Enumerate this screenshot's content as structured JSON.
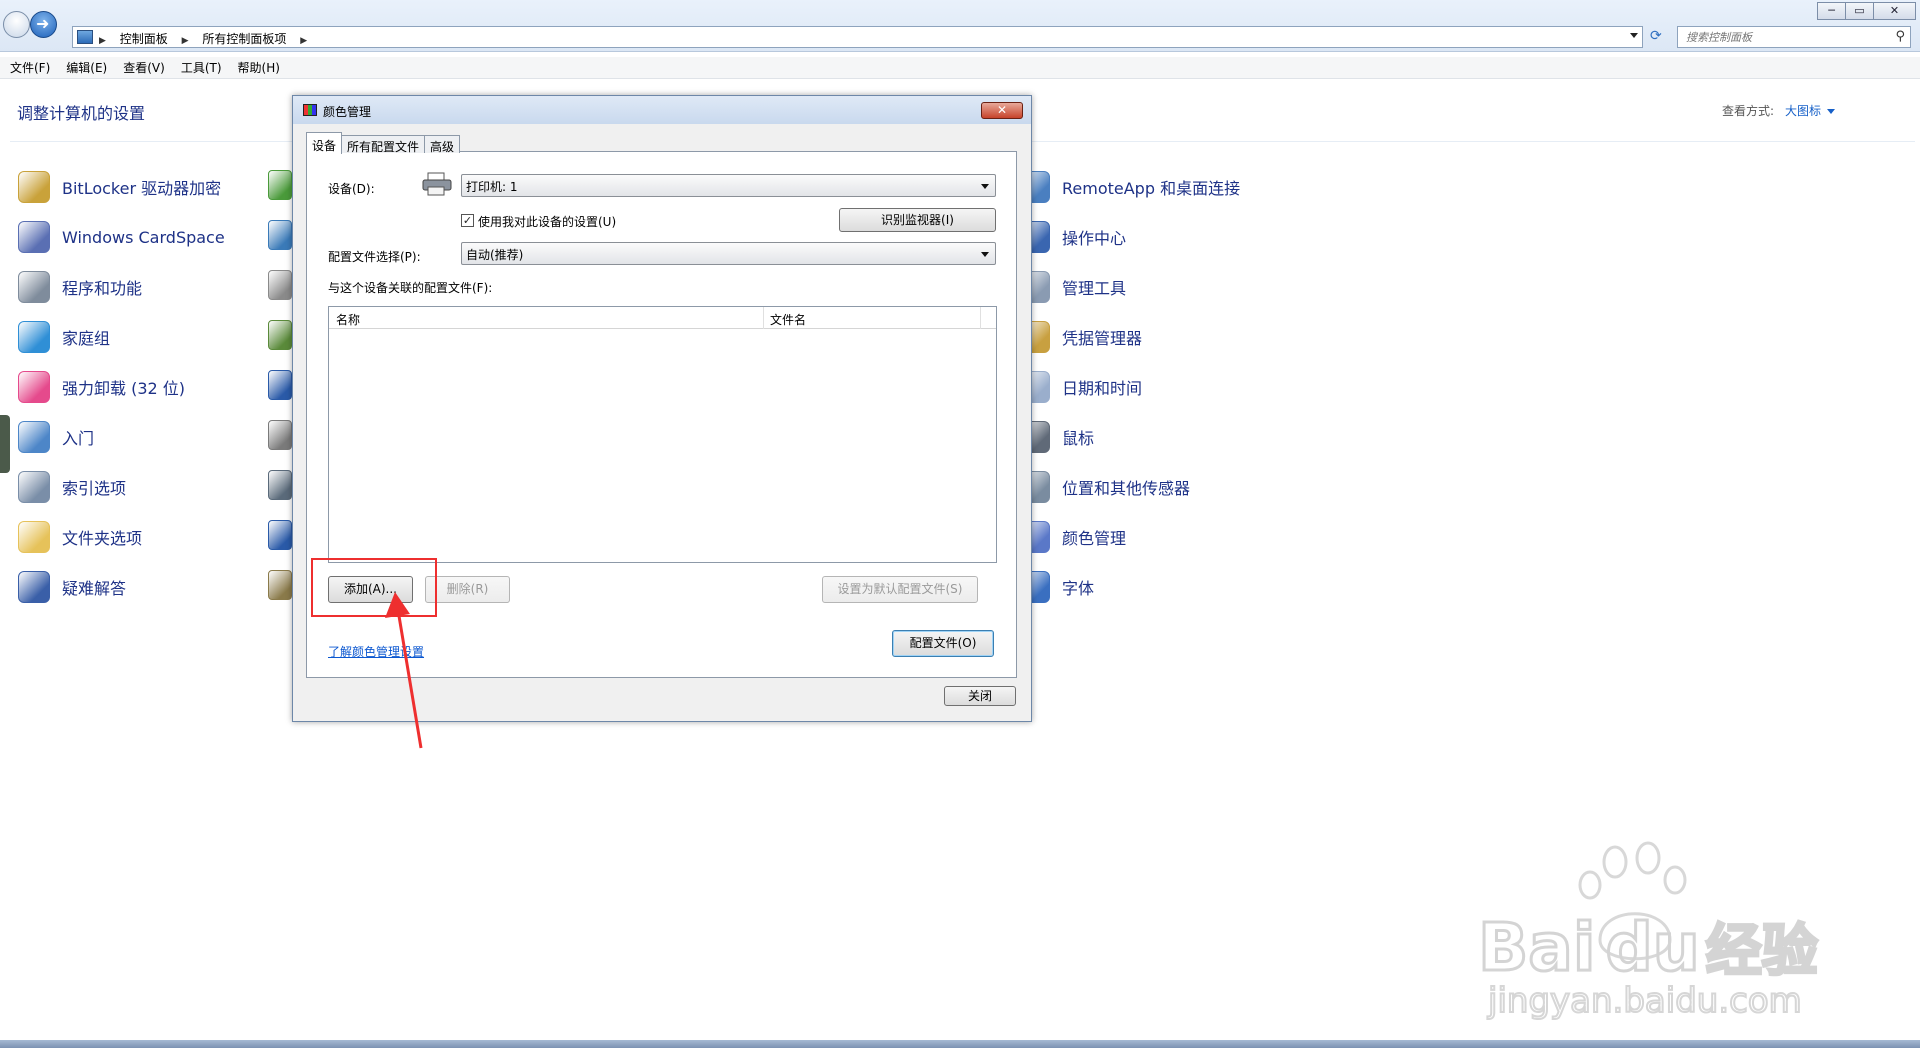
{
  "address": {
    "crumbs": [
      "控制面板",
      "所有控制面板项"
    ],
    "search_placeholder": "搜索控制面板"
  },
  "window_buttons": {
    "minimize": "─",
    "maximize": "▭",
    "close": "✕"
  },
  "menu": [
    "文件(F)",
    "编辑(E)",
    "查看(V)",
    "工具(T)",
    "帮助(H)"
  ],
  "panel": {
    "title": "调整计算机的设置",
    "view_label": "查看方式:",
    "view_value": "大图标"
  },
  "left_items": [
    {
      "label": "BitLocker 驱动器加密",
      "icon": "bitlocker-icon",
      "color": "#c9a23a"
    },
    {
      "label": "Windows CardSpace",
      "icon": "cardspace-icon",
      "color": "#5a6fb3"
    },
    {
      "label": "程序和功能",
      "icon": "programs-icon",
      "color": "#7f8c9c"
    },
    {
      "label": "家庭组",
      "icon": "homegroup-icon",
      "color": "#2f8fd6"
    },
    {
      "label": "强力卸载 (32 位)",
      "icon": "uninstall-icon",
      "color": "#e54a8c"
    },
    {
      "label": "入门",
      "icon": "getting-started-icon",
      "color": "#4d86c8"
    },
    {
      "label": "索引选项",
      "icon": "indexing-icon",
      "color": "#7a8ea8"
    },
    {
      "label": "文件夹选项",
      "icon": "folder-options-icon",
      "color": "#e6c25a"
    },
    {
      "label": "疑难解答",
      "icon": "troubleshoot-icon",
      "color": "#3a5fa8"
    }
  ],
  "right_items": [
    {
      "label": "RemoteApp 和桌面连接",
      "icon": "remoteapp-icon",
      "color": "#4a7fc0"
    },
    {
      "label": "操作中心",
      "icon": "action-center-icon",
      "color": "#3a66b0"
    },
    {
      "label": "管理工具",
      "icon": "admin-tools-icon",
      "color": "#8a9bb2"
    },
    {
      "label": "凭据管理器",
      "icon": "credential-icon",
      "color": "#c8a040"
    },
    {
      "label": "日期和时间",
      "icon": "clock-icon",
      "color": "#9aaecc"
    },
    {
      "label": "鼠标",
      "icon": "mouse-icon",
      "color": "#606a78"
    },
    {
      "label": "位置和其他传感器",
      "icon": "sensor-icon",
      "color": "#7a8ca0"
    },
    {
      "label": "颜色管理",
      "icon": "color-mgmt-icon",
      "color": "#5a78c8"
    },
    {
      "label": "字体",
      "icon": "font-icon",
      "color": "#3a6fc0"
    }
  ],
  "middle_icon_colors": [
    "#4a9a3a",
    "#3a7ab8",
    "#8a8a8a",
    "#5a8a3a",
    "#2a5aa8",
    "#7a7a7a",
    "#5a6a7a",
    "#2a5aa8",
    "#8a7a4a"
  ],
  "dialog": {
    "title": "颜色管理",
    "close": "✕",
    "tabs": [
      "设备",
      "所有配置文件",
      "高级"
    ],
    "device_label": "设备(D):",
    "device_value": "打印机: 1",
    "use_settings_label": "使用我对此设备的设置(U)",
    "use_settings_checked": "✓",
    "identify_monitor": "识别监视器(I)",
    "profile_select_label": "配置文件选择(P):",
    "profile_select_value": "自动(推荐)",
    "associated_label": "与这个设备关联的配置文件(F):",
    "col_name": "名称",
    "col_filename": "文件名",
    "add_button": "添加(A)...",
    "remove_button": "删除(R)",
    "set_default_button": "设置为默认配置文件(S)",
    "learn_link": "了解颜色管理设置",
    "profiles_button": "配置文件(O)",
    "close_button": "关闭"
  },
  "watermark": {
    "brand": "Bai",
    "brand2": "du",
    "cn": "经验",
    "url": "jingyan.baidu.com"
  },
  "colors": {
    "link": "#1e3287",
    "annotation": "#ee2f2f"
  }
}
